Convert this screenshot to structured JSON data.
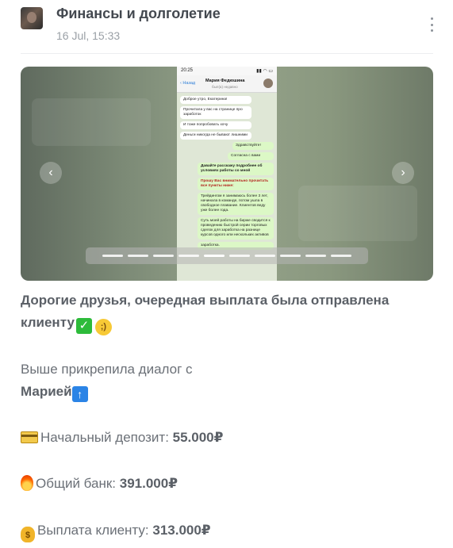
{
  "header": {
    "channel_title": "Финансы и долголетие",
    "date": "16 Jul, 15:33"
  },
  "screenshot_chat": {
    "status_time": "20:25",
    "back_label": "Назад",
    "contact_name": "Мария Федюшина",
    "contact_status": "был(а) недавно",
    "messages": [
      {
        "dir": "in",
        "text": "Доброе утро, Екатерина!"
      },
      {
        "dir": "in",
        "text": "Прочитала у вас на странице про заработок"
      },
      {
        "dir": "in",
        "text": "И тоже попробовать хочу"
      },
      {
        "dir": "in",
        "text": "Деньги никогда не бывают лишними"
      },
      {
        "dir": "out",
        "text": "Здравствуйте!"
      },
      {
        "dir": "out",
        "text": "Согласна с вами"
      },
      {
        "dir": "out",
        "text": "Давайте расскажу подробнее об условиях работы со мной"
      },
      {
        "dir": "out",
        "text": "Прошу Вас внимательно прочитать все пункты ниже:"
      },
      {
        "dir": "out",
        "text": "Трейдингом я занимаюсь более 3 лет, начинала в команде, потом ушла в свободное плавание. Клиентов веду уже более года."
      },
      {
        "dir": "out",
        "text": "Суть моей работы на бирже сводится к проведению быстрой серии торговых сделок для заработка на разнице курсов одного или нескольких активов"
      },
      {
        "dir": "out",
        "text": "заработка."
      }
    ]
  },
  "gallery": {
    "slide_count": 11,
    "active_slide": 5
  },
  "post": {
    "line1": "Дорогие друзья, очередная выплата была отправлена",
    "line2": "клиенту",
    "line3": "Выше прикрепила диалог с",
    "line4": "Марией",
    "deposit_label": "Начальный депозит: ",
    "deposit_value": "55.000₽",
    "bank_label": "Общий банк: ",
    "bank_value": "391.000₽",
    "payout_label": "Выплата клиенту: ",
    "payout_value": "313.000₽"
  },
  "icons": {
    "menu": "vertical-dots-icon",
    "prev": "chevron-left-icon",
    "next": "chevron-right-icon",
    "check": "check-mark-emoji",
    "wink": "winking-face-emoji",
    "up": "up-arrow-emoji",
    "card": "credit-card-emoji",
    "fire": "fire-emoji",
    "bag": "money-bag-emoji"
  },
  "colors": {
    "title": "#43484f",
    "text": "#6b7077",
    "date": "#9aa0a6"
  }
}
